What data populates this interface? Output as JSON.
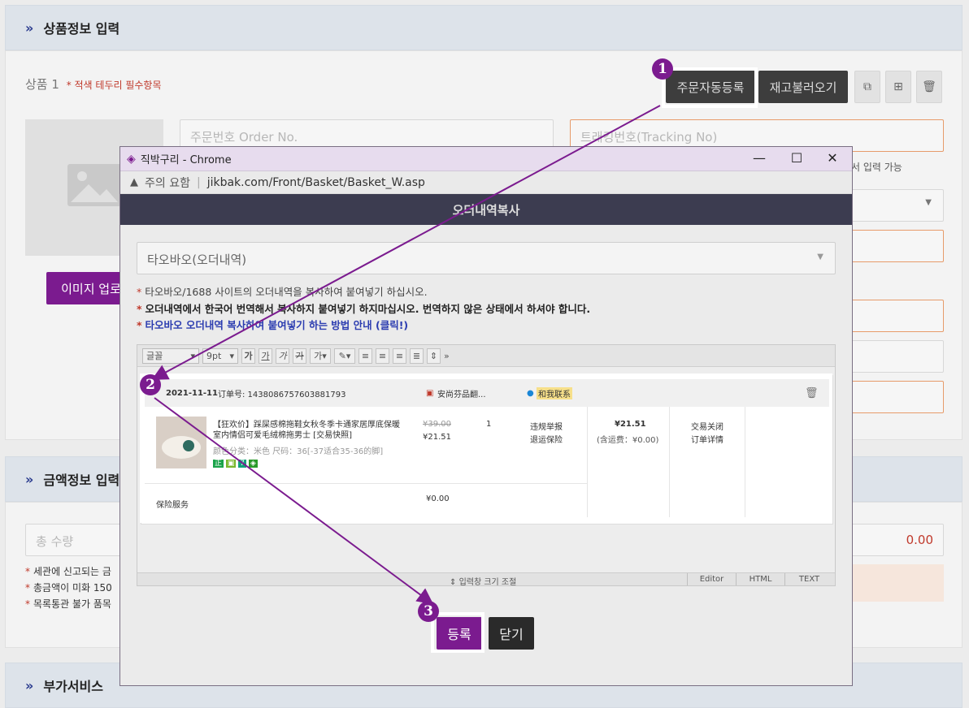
{
  "colors": {
    "accent": "#7b1b8f",
    "dark_button": "#3d3d3d",
    "required": "#c0392b",
    "orange_border": "#e79b6a"
  },
  "section1": {
    "title": "상품정보 입력"
  },
  "product": {
    "label": "상품 1",
    "required_note": "* 적색 테두리 필수항목",
    "auto_order_button": "주문자동등록",
    "reload_stock_button": "재고불러오기",
    "order_no_placeholder": "주문번호 Order No.",
    "tracking_placeholder": "트래킹번호(Tracking No)",
    "tracking_hint": "서 입력 가능",
    "image_upload_button": "이미지 업로"
  },
  "section2": {
    "title": "금액정보 입력"
  },
  "amount": {
    "total_qty_placeholder": "총 수량",
    "total_value": "0.00",
    "notes": [
      "세관에 신고되는 금",
      "총금액이 미화 150",
      "목록통관 불가 품목"
    ]
  },
  "section3": {
    "title": "부가서비스"
  },
  "popup": {
    "window_title": "직박구리 - Chrome",
    "security_label": "주의 요함",
    "url": "jikbak.com/Front/Basket/Basket_W.asp",
    "header": "오더내역복사",
    "select_value": "타오바오(오더내역)",
    "note1": "타오바오/1688 사이트의 오더내역을 복사하여 붙여넣기 하십시오.",
    "note2": "오더내역에서 한국어 번역해서 복사하지 붙여넣기 하지마십시오. 번역하지 않은 상태에서 하셔야 합니다.",
    "note3": "타오바오 오더내역 복사하여 붙여넣기 하는 방법 안내 (클릭!)",
    "toolbar": {
      "font": "글꼴",
      "size": "9pt"
    },
    "order": {
      "date": "2021-11-11",
      "order_no": "订单号: 1438086757603881793",
      "shop": "安尚芬品翻...",
      "contact": "和我联系",
      "product_title": "【狂欢价】踩屎感棉拖鞋女秋冬季卡通家居厚底保暖室内情侣可爱毛绒棉拖男士 [交易快照]",
      "product_spec": "颜色分类：米色  尺码：36[-37适合35-36的脚]",
      "orig_price": "¥39.00",
      "price": "¥21.51",
      "qty": "1",
      "action1": "违规举报",
      "action2": "退运保险",
      "total": "¥21.51",
      "shipping": "(含运费：¥0.00)",
      "status1": "交易关闭",
      "status2": "订单详情",
      "insurance_label": "保险服务",
      "insurance_price": "¥0.00"
    },
    "resize_label": "입력창 크기 조절",
    "tabs": [
      "Editor",
      "HTML",
      "TEXT"
    ],
    "submit_button": "등록",
    "close_button": "닫기"
  },
  "callouts": [
    "1",
    "2",
    "3"
  ]
}
